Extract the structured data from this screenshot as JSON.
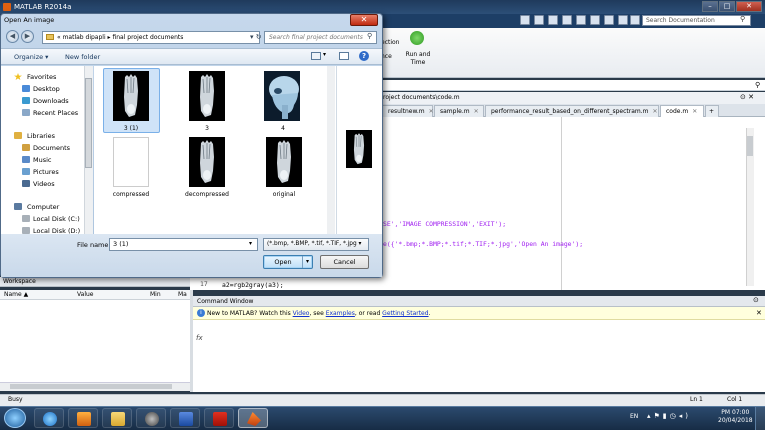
{
  "matlab": {
    "window_title": "MATLAB R2014a",
    "search_placeholder": "Search Documentation",
    "toolstrip": {
      "text1": "ection",
      "text2": "nce",
      "run_label": "Run and Time"
    },
    "editor": {
      "path": "roject documents\\code.m",
      "tabs": [
        {
          "label": "resultnew.m"
        },
        {
          "label": "sample.m"
        },
        {
          "label": "performance_result_based_on_different_spectram.m"
        },
        {
          "label": "code.m"
        }
      ],
      "add_tab": "+",
      "code_line1": "SE','IMAGE COMPRESSION','EXIT');",
      "code_line2": "e({'*.bmp;*.BMP;*.tif;*.TIF;*.jpg','Open An image');",
      "line_number": "17",
      "code_line3": "a2=rgb2gray(a3);"
    },
    "workspace": {
      "title": "Workspace",
      "columns": [
        "Name ▲",
        "Value",
        "Min",
        "Ma"
      ]
    },
    "command_window": {
      "title": "Command Window",
      "info_text_1": "New to MATLAB? Watch this",
      "info_link_video": "Video",
      "info_text_2": ", see",
      "info_link_examples": "Examples",
      "info_text_3": ", or read",
      "info_link_started": "Getting Started",
      "info_text_4": ".",
      "prompt": "fx"
    },
    "status": {
      "busy": "Busy",
      "ln": "Ln  1",
      "col": "Col  1"
    }
  },
  "dialog": {
    "title": "Open An image",
    "address": "« matlab dipapli  ▸  final project documents",
    "search_placeholder": "Search final project documents",
    "organize_label": "Organize ▾",
    "new_folder_label": "New folder",
    "nav": {
      "favorites": "Favorites",
      "favorites_items": [
        "Desktop",
        "Downloads",
        "Recent Places"
      ],
      "libraries": "Libraries",
      "libraries_items": [
        "Documents",
        "Music",
        "Pictures",
        "Videos"
      ],
      "computer": "Computer",
      "computer_items": [
        "Local Disk (C:)",
        "Local Disk (D:)"
      ]
    },
    "files": [
      {
        "name": "3 (1)",
        "kind": "foot-xray",
        "selected": true
      },
      {
        "name": "3",
        "kind": "foot-xray"
      },
      {
        "name": "4",
        "kind": "skull-xray"
      },
      {
        "name": "compressed",
        "kind": "blank"
      },
      {
        "name": "decompressed",
        "kind": "foot-xray"
      },
      {
        "name": "original",
        "kind": "foot-xray"
      }
    ],
    "file_name_label": "File name:",
    "file_name_value": "3 (1)",
    "filter_value": "(*.bmp, *.BMP, *.tif, *.TIF, *.jpg",
    "open_label": "Open",
    "cancel_label": "Cancel"
  },
  "taskbar": {
    "language": "EN",
    "time": "PM 07:00",
    "date": "20/04/2018"
  },
  "colors": {
    "matlab_tab_active": "#ffffff",
    "info_bar": "#ffffdd",
    "link": "#1030d0",
    "string_literal": "#a020f0"
  }
}
